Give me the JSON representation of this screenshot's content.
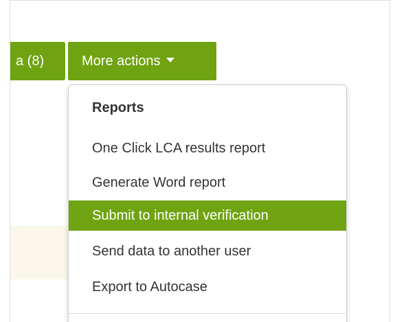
{
  "toolbar": {
    "partial_button_label": "a (8)",
    "more_actions_label": "More actions"
  },
  "dropdown": {
    "section_header": "Reports",
    "items": [
      {
        "label": "One Click LCA results report"
      },
      {
        "label": "Generate Word report"
      },
      {
        "label": "Submit to internal verification",
        "active": true
      },
      {
        "label": "Send data to another user"
      },
      {
        "label": "Export to Autocase"
      }
    ]
  },
  "colors": {
    "accent": "#6fa312",
    "text": "#333333",
    "cream": "#fbf7ea"
  },
  "icons": {
    "more_actions_caret": "caret-down-icon"
  }
}
